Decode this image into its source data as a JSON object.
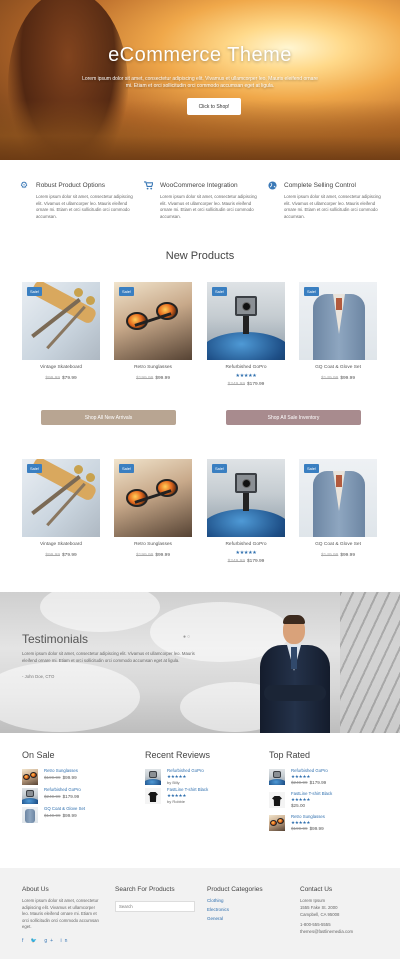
{
  "hero": {
    "title": "eCommerce Theme",
    "text": "Lorem ipsum dolor sit amet, consectetur adipiscing elit. Vivamus et ullamcorper leo. Mauris eleifend ornare mi. Etiam et orci sollicitudin orci commodo accumsan eget at ligula.",
    "button": "Click to Shop!"
  },
  "features": [
    {
      "icon": "gear-icon",
      "title": "Robust Product Options",
      "text": "Lorem ipsum dolor sit amet, consectetur adipiscing elit. Vivamus et ullamcorper leo. Mauris eleifend ornare mi. Etiam et orci sollicitudin orci commodo accumsan."
    },
    {
      "icon": "cart-icon",
      "title": "WooCommerce Integration",
      "text": "Lorem ipsum dolor sit amet, consectetur adipiscing elit. Vivamus et ullamcorper leo. Mauris eleifend ornare mi. Etiam et orci sollicitudin orci commodo accumsan."
    },
    {
      "icon": "globe-icon",
      "title": "Complete Selling Control",
      "text": "Lorem ipsum dolor sit amet, consectetur adipiscing elit. Vivamus et ullamcorper leo. Mauris eleifend ornare mi. Etiam et orci sollicitudin orci commodo accumsan."
    }
  ],
  "new_products_title": "New Products",
  "sale_badge": "Sale!",
  "products": [
    {
      "name": "Vintage Skateboard",
      "old_price": "$99.99",
      "price": "$79.99",
      "rating": ""
    },
    {
      "name": "Retro Sunglasses",
      "old_price": "$199.99",
      "price": "$99.99",
      "rating": ""
    },
    {
      "name": "Refurbished GoPro",
      "old_price": "$249.99",
      "price": "$179.99",
      "rating": "★★★★★"
    },
    {
      "name": "GQ Coat & Glove Set",
      "old_price": "$149.99",
      "price": "$99.99",
      "rating": ""
    }
  ],
  "buttons": {
    "new_arrivals": "Shop All New Arrivals",
    "sale_inventory": "Shop All Sale Inventory"
  },
  "testimonials": {
    "title": "Testimonials",
    "text": "Lorem ipsum dolor sit amet, consectetur adipiscing elit. Vivamus et ullamcorper leo. Mauris eleifend ornare mi. Etiam et orci sollicitudin orci commodo accumsan eget at ligula.",
    "author": "- John Doe, CTO"
  },
  "on_sale": {
    "title": "On Sale",
    "items": [
      {
        "name": "Retro Sunglasses",
        "old_price": "$199.99",
        "price": "$99.99"
      },
      {
        "name": "Refurbished GoPro",
        "old_price": "$249.99",
        "price": "$179.99"
      },
      {
        "name": "GQ Coat & Glove Set",
        "old_price": "$149.99",
        "price": "$99.99"
      }
    ]
  },
  "recent_reviews": {
    "title": "Recent Reviews",
    "items": [
      {
        "name": "Refurbished GoPro",
        "rating": "★★★★★",
        "by": "by Billy"
      },
      {
        "name": "FastLine T-shirt Black",
        "rating": "★★★★★",
        "by": "by Robbie"
      }
    ]
  },
  "top_rated": {
    "title": "Top Rated",
    "items": [
      {
        "name": "Refurbished GoPro",
        "rating": "★★★★★",
        "old_price": "$249.99",
        "price": "$179.99"
      },
      {
        "name": "FastLine T-shirt Black",
        "rating": "★★★★★",
        "old_price": "",
        "price": "$25.00"
      },
      {
        "name": "Retro Sunglasses",
        "rating": "★★★★★",
        "old_price": "$199.99",
        "price": "$99.99"
      }
    ]
  },
  "footer": {
    "about": {
      "title": "About Us",
      "text": "Lorem ipsum dolor sit amet, consectetur adipiscing elit. Vivamus et ullamcorper leo. Mauris eleifend ornare mi. Etiam et orci sollicitudin orci commodo accumsan eget."
    },
    "search": {
      "title": "Search For Products",
      "placeholder": "Search"
    },
    "categories": {
      "title": "Product Categories",
      "items": [
        "Clothing",
        "Electronics",
        "General"
      ]
    },
    "contact": {
      "title": "Contact Us",
      "lines": [
        "Lorem Ipsum",
        "1555 Fake St. 2000",
        "Campbell, CA 95008",
        "1-800-555-5555",
        "themes@fastlinemedia.com"
      ]
    },
    "social": "f  🐦  g+  in"
  },
  "colors": {
    "accent": "#3a7fc1",
    "link": "#2f6fae",
    "btn_tan": "#b8a592",
    "btn_mauve": "#a88b8e"
  }
}
